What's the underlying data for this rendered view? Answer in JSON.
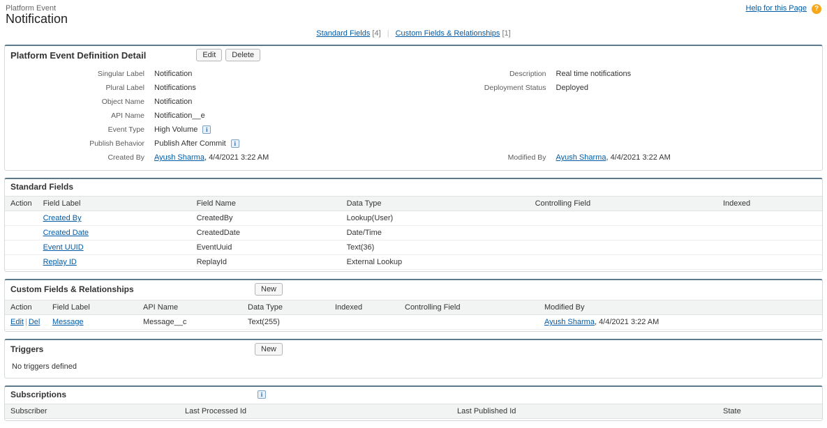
{
  "header": {
    "kicker": "Platform Event",
    "title": "Notification",
    "help_text": "Help for this Page"
  },
  "anchors": {
    "std_label": "Standard Fields",
    "std_count": "[4]",
    "cust_label": "Custom Fields & Relationships",
    "cust_count": "[1]"
  },
  "detail": {
    "title": "Platform Event Definition Detail",
    "edit_btn": "Edit",
    "delete_btn": "Delete",
    "labels": {
      "singular": "Singular Label",
      "plural": "Plural Label",
      "objname": "Object Name",
      "apiname": "API Name",
      "eventtype": "Event Type",
      "pubbehavior": "Publish Behavior",
      "createdby": "Created By",
      "description": "Description",
      "deploystatus": "Deployment Status",
      "modifiedby": "Modified By"
    },
    "values": {
      "singular": "Notification",
      "plural": "Notifications",
      "objname": "Notification",
      "apiname": "Notification__e",
      "eventtype": "High Volume",
      "pubbehavior": "Publish After Commit",
      "createdby_user": "Ayush Sharma",
      "createdby_ts": ", 4/4/2021 3:22 AM",
      "description": "Real time notifications",
      "deploystatus": "Deployed",
      "modifiedby_user": "Ayush Sharma",
      "modifiedby_ts": ", 4/4/2021 3:22 AM"
    }
  },
  "stdFields": {
    "title": "Standard Fields",
    "columns": {
      "action": "Action",
      "label": "Field Label",
      "name": "Field Name",
      "type": "Data Type",
      "ctrl": "Controlling Field",
      "indexed": "Indexed"
    },
    "rows": [
      {
        "label": "Created By",
        "name": "CreatedBy",
        "type": "Lookup(User)",
        "ctrl": "",
        "indexed": ""
      },
      {
        "label": "Created Date",
        "name": "CreatedDate",
        "type": "Date/Time",
        "ctrl": "",
        "indexed": ""
      },
      {
        "label": "Event UUID",
        "name": "EventUuid",
        "type": "Text(36)",
        "ctrl": "",
        "indexed": ""
      },
      {
        "label": "Replay ID",
        "name": "ReplayId",
        "type": "External Lookup",
        "ctrl": "",
        "indexed": ""
      }
    ]
  },
  "custFields": {
    "title": "Custom Fields & Relationships",
    "new_btn": "New",
    "columns": {
      "action": "Action",
      "label": "Field Label",
      "api": "API Name",
      "type": "Data Type",
      "indexed": "Indexed",
      "ctrl": "Controlling Field",
      "modby": "Modified By"
    },
    "action_edit": "Edit",
    "action_del": "Del",
    "rows": [
      {
        "label": "Message",
        "api": "Message__c",
        "type": "Text(255)",
        "indexed": "",
        "ctrl": "",
        "modby_user": "Ayush Sharma",
        "modby_ts": ", 4/4/2021 3:22 AM"
      }
    ]
  },
  "triggers": {
    "title": "Triggers",
    "new_btn": "New",
    "empty": "No triggers defined"
  },
  "subs": {
    "title": "Subscriptions",
    "columns": {
      "subscriber": "Subscriber",
      "lastproc": "Last Processed Id",
      "lastpub": "Last Published Id",
      "state": "State"
    }
  }
}
